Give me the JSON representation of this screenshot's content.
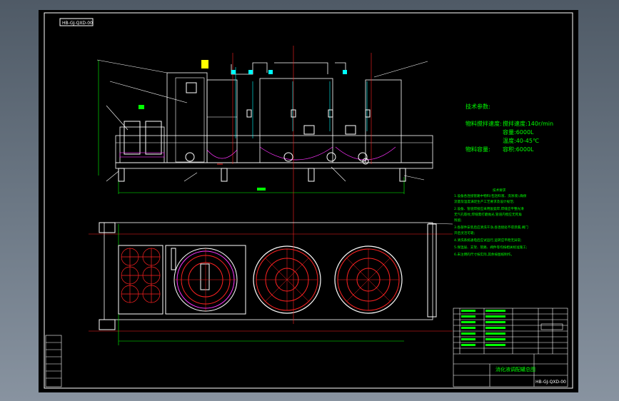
{
  "drawing": {
    "code_top": "HB-GJ-QXD-00",
    "tech_params_heading": "技术参数:",
    "params": [
      {
        "label": "物料搅拌速度:",
        "text": "搅拌速度:140r/min"
      },
      {
        "label": "",
        "text": "容量:6000L"
      },
      {
        "label": "",
        "text": "温度:40-45℃"
      },
      {
        "label": "物料容量:",
        "text": "容积:6000L"
      }
    ],
    "tech_req_heading": "技术要求",
    "tech_req_lines": [
      "1.设备各连接管路中物料(包括料液、洗涤液),确保",
      "流量及温度满足生产工艺要求及设计规范;",
      "2.设备、管道焊接应采用氩弧焊,焊缝应平整光滑",
      "无气孔裂纹,焊缝需打磨抛光,管道内壁应无死角",
      "残留;",
      "3.各部件安装后应清洗干净,各连接处不得渗漏,阀门",
      "开启灵活可靠;",
      "4.清洗系统通电后应试运行,运转应平稳无异常;",
      "5.保温层、支架、管路、阀件等均按相关标准施工;",
      "6.未注明的尺寸按实际,其余按图纸制作。"
    ],
    "title_block": {
      "title": "消化液调配罐总图",
      "code": "HB-GJ-QXD-00"
    }
  },
  "colors": {
    "background": "#000000",
    "frame": "#ffffff",
    "red": "#ff2222",
    "green": "#00ff00",
    "magenta": "#ff33ff",
    "yellow": "#ffff00",
    "cyan": "#00ffff"
  }
}
